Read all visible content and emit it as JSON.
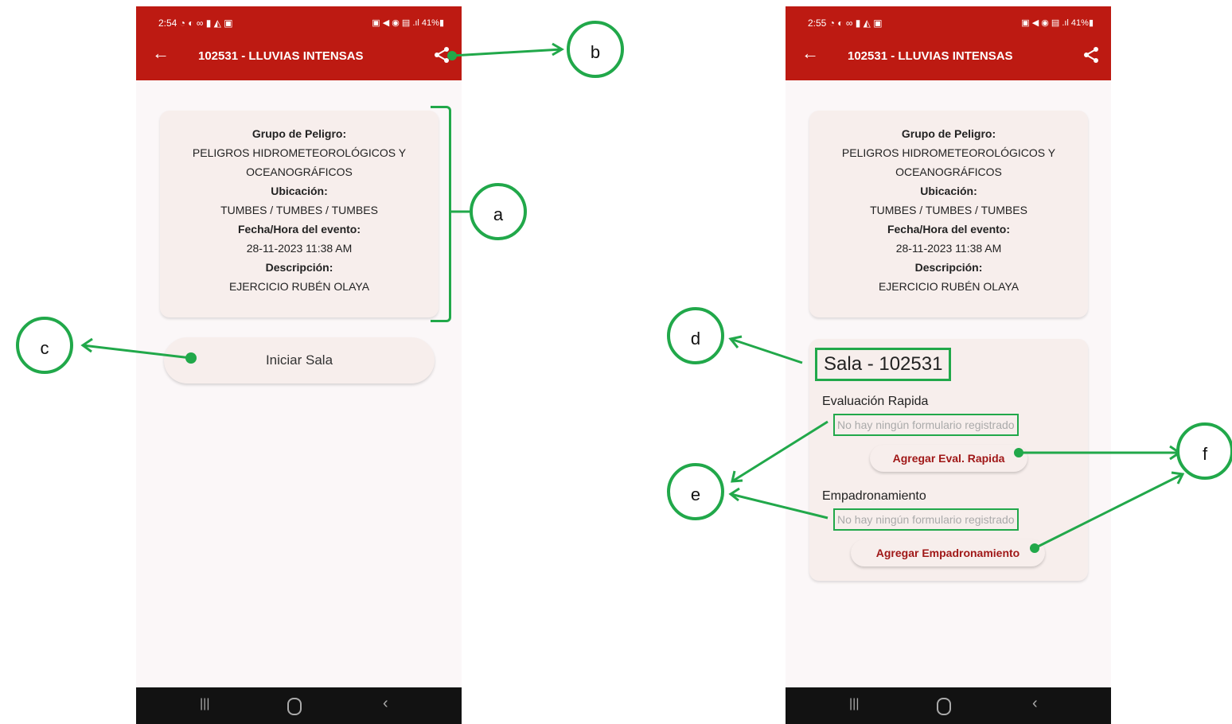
{
  "left_screen": {
    "status": {
      "time": "2:54 ◔ ◐ ∞ ▮ ◭ ▣",
      "icons": "▣ ◀ ◉ ▤ .ıl 41%▮"
    },
    "appbar": {
      "title": "102531 - LLUVIAS INTENSAS"
    },
    "card": {
      "group_label": "Grupo de Peligro:",
      "group_value_1": "PELIGROS HIDROMETEOROLÓGICOS Y",
      "group_value_2": "OCEANOGRÁFICOS",
      "location_label": "Ubicación:",
      "location_value": "TUMBES / TUMBES / TUMBES",
      "date_label": "Fecha/Hora del evento:",
      "date_value": "28-11-2023 11:38 AM",
      "desc_label": "Descripción:",
      "desc_value": "EJERCICIO RUBÉN OLAYA"
    },
    "start_button": "Iniciar Sala"
  },
  "right_screen": {
    "status": {
      "time": "2:55 ◔ ◐ ∞ ▮ ◭ ▣",
      "icons": "▣ ◀ ◉ ▤ .ıl 41%▮"
    },
    "appbar": {
      "title": "102531 - LLUVIAS INTENSAS"
    },
    "card": {
      "group_label": "Grupo de Peligro:",
      "group_value_1": "PELIGROS HIDROMETEOROLÓGICOS Y",
      "group_value_2": "OCEANOGRÁFICOS",
      "location_label": "Ubicación:",
      "location_value": "TUMBES / TUMBES / TUMBES",
      "date_label": "Fecha/Hora del evento:",
      "date_value": "28-11-2023 11:38 AM",
      "desc_label": "Descripción:",
      "desc_value": "EJERCICIO RUBÉN OLAYA"
    },
    "sala": {
      "title": "Sala - 102531",
      "eval_title": "Evaluación Rapida",
      "eval_empty": "No hay ningún formulario registrado",
      "eval_button": "Agregar Eval. Rapida",
      "emp_title": "Empadronamiento",
      "emp_empty": "No hay ningún formulario registrado",
      "emp_button": "Agregar Empadronamiento"
    }
  },
  "navbar": {
    "recent": "|||",
    "back": "‹"
  },
  "callouts": {
    "a": "a",
    "b": "b",
    "c": "c",
    "d": "d",
    "e": "e",
    "f": "f"
  },
  "colors": {
    "appbar": "#bd1a12",
    "annotation": "#21a84a",
    "button_text": "#a01818"
  }
}
